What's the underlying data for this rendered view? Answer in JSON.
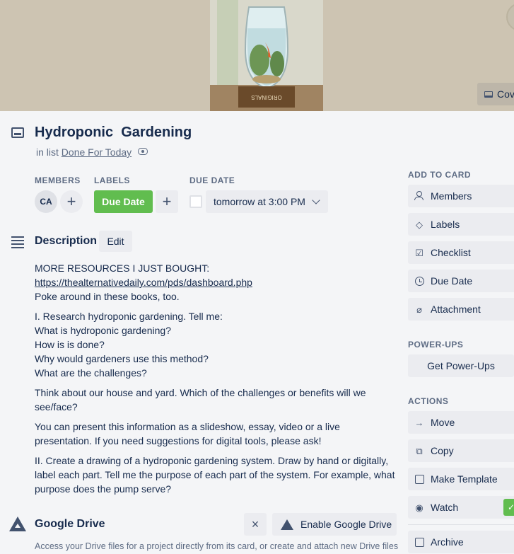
{
  "card": {
    "title": "Hydroponic  Gardening",
    "in_list_prefix": "in list",
    "list_name": "Done For Today"
  },
  "cover": {
    "button_label": "Cov",
    "image_label": "ORIGINALS"
  },
  "labels": {
    "members": "MEMBERS",
    "labels": "LABELS",
    "due_date": "DUE DATE"
  },
  "member_initials": "CA",
  "label_chip": "Due Date",
  "due_value": "tomorrow at 3:00 PM",
  "description": {
    "title": "Description",
    "edit_label": "Edit",
    "lines1": [
      "MORE RESOURCES I JUST BOUGHT:"
    ],
    "link": "https://thealternativedaily.com/pds/dashboard.php",
    "lines1b": [
      "Poke around in these books, too."
    ],
    "para2": [
      "I. Research hydroponic gardening. Tell me:",
      "What is hydroponic gardening?",
      "How is is done?",
      "Why would gardeners use this method?",
      "What are the challenges?"
    ],
    "para3": "Think about our house and yard. Which of the challenges or benefits will we see/face?",
    "para4": "You can present this information as a slideshow, essay, video or a live presentation. If you need suggestions for digital tools, please ask!",
    "para5": "II. Create a drawing of a hydroponic gardening system. Draw by hand or digitally, label each part. Tell me the purpose of each part of the system. For example, what purpose does the pump serve?"
  },
  "google_drive": {
    "title": "Google Drive",
    "close_label": "×",
    "enable_label": "Enable Google Drive",
    "text": "Access your Drive files for a project directly from its card, or create and attach new Drive files"
  },
  "sidebar": {
    "add_to_card": "ADD TO CARD",
    "add_items": [
      "Members",
      "Labels",
      "Checklist",
      "Due Date",
      "Attachment"
    ],
    "power_ups": "POWER-UPS",
    "get_power_ups": "Get Power-Ups",
    "actions": "ACTIONS",
    "action_items": [
      "Move",
      "Copy",
      "Make Template",
      "Watch"
    ],
    "archive": "Archive",
    "watch_check": "✓"
  },
  "colors": {
    "label_green": "#61bd4f",
    "background": "#f4f5f7",
    "button_bg": "#ebecf0",
    "text": "#172b4d"
  }
}
